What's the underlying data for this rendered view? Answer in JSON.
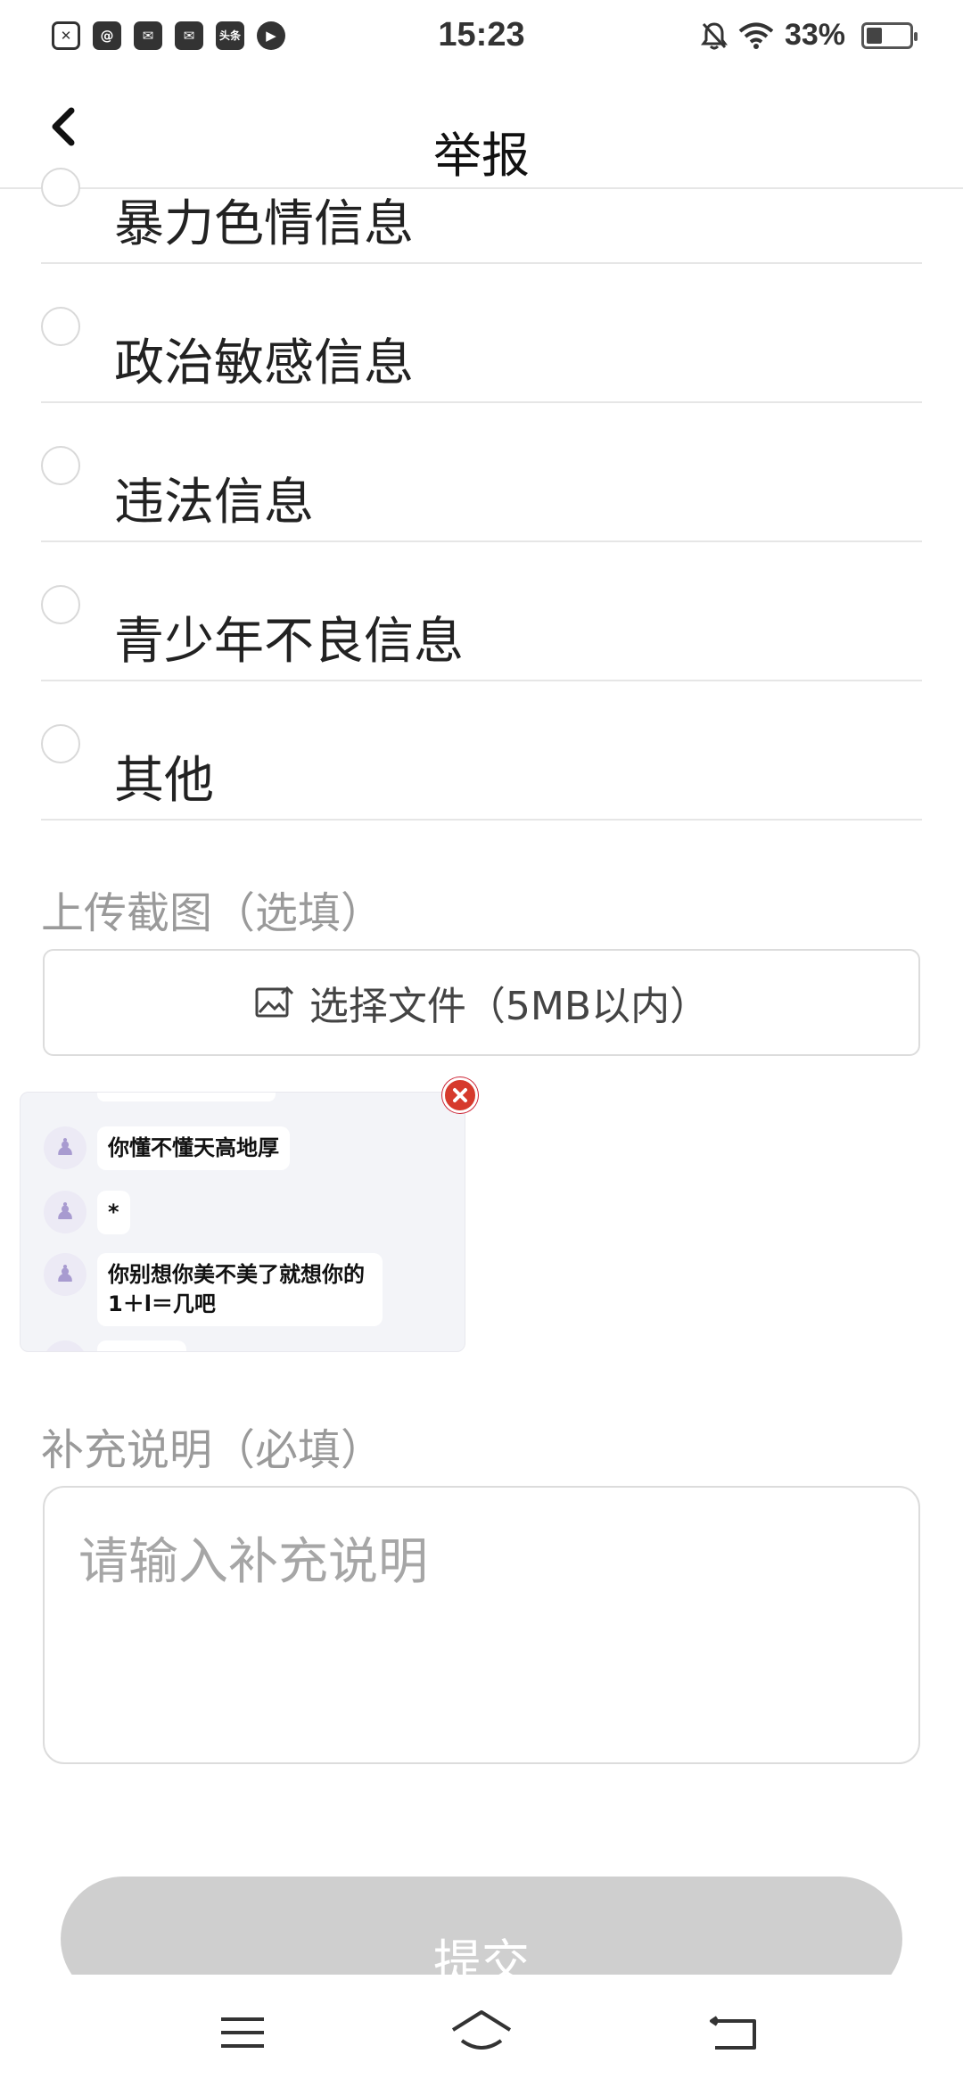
{
  "status_bar": {
    "time": "15:23",
    "battery": "33%",
    "battery_level": 0.33,
    "left_icons": [
      "close-box-icon",
      "at-sign-icon",
      "mail-icon",
      "mail-icon",
      "toutiao-app-icon",
      "flame-play-icon"
    ],
    "left_icon_texts": [
      "",
      "@",
      "",
      "",
      "头条",
      ""
    ],
    "right_icons": [
      "bell-off-icon",
      "wifi-icon",
      "battery-icon"
    ]
  },
  "header": {
    "title": "举报",
    "back_icon": "chevron-left-icon"
  },
  "options": [
    {
      "label": "暴力色情信息"
    },
    {
      "label": "政治敏感信息"
    },
    {
      "label": "违法信息"
    },
    {
      "label": "青少年不良信息"
    },
    {
      "label": "其他"
    }
  ],
  "upload": {
    "section_label": "上传截图（选填）",
    "button_label": "选择文件（5MB以内）",
    "button_icon": "image-upload-icon"
  },
  "screenshot_thumb": {
    "messages": [
      {
        "text": "你懂不懂天高地厚"
      },
      {
        "text": "*"
      },
      {
        "text": "你别想你美不美了就想你的1＋l＝几吧"
      }
    ],
    "remove_icon": "close-circle-icon"
  },
  "description": {
    "section_label": "补充说明（必填）",
    "placeholder": "请输入补充说明",
    "value": ""
  },
  "submit": {
    "label": "提交"
  },
  "nav_bar": {
    "icons": [
      "menu-icon",
      "home-icon",
      "back-icon"
    ]
  },
  "colors": {
    "accent_remove": "#d63a2c",
    "submit_disabled": "#cfcfcf",
    "label_gray": "#9a9a9a"
  }
}
